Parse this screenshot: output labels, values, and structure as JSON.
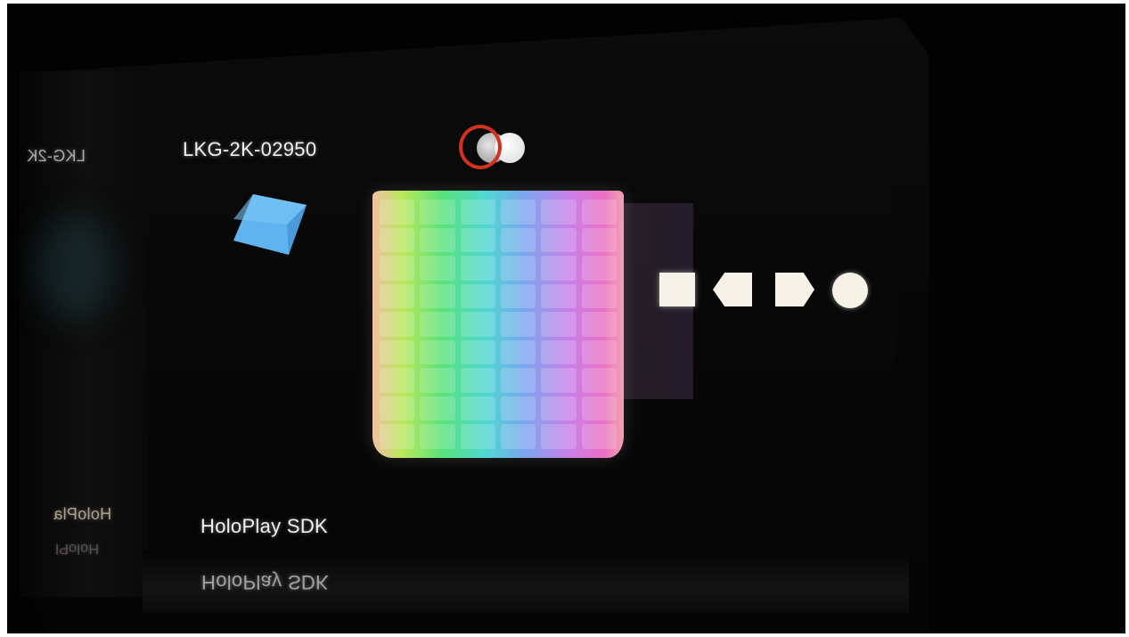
{
  "device": {
    "serial_label": "LKG-2K-02950",
    "serial_mirror": "LKG-2K",
    "sdk_label": "HoloPlay SDK",
    "sdk_reflection": "HoloPlay SDK",
    "sdk_mirror_left": "HoloPla",
    "sdk_reflection_left": "HoloPl"
  },
  "scene": {
    "cube_color": "#5fb4f0",
    "indicator_ring_color": "#d1311f",
    "shape_color": "#f7f2e8",
    "shapes": [
      "square",
      "arrow-left",
      "arrow-right",
      "circle"
    ]
  },
  "color_grid": {
    "rows": 9,
    "columns": 6
  }
}
